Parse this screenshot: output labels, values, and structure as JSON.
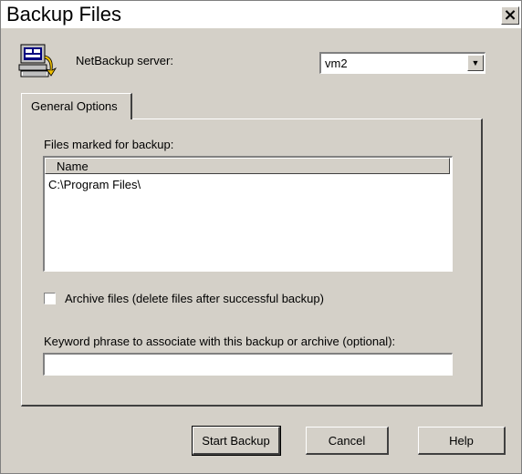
{
  "window": {
    "title": "Backup Files",
    "close_glyph": "×"
  },
  "server": {
    "icon": "computer-server-icon",
    "label": "NetBackup server:",
    "selected": "vm2",
    "arrow_glyph": "▼"
  },
  "tabs": [
    {
      "label": "General Options",
      "active": true
    }
  ],
  "files": {
    "label": "Files marked for backup:",
    "columns": [
      "Name"
    ],
    "rows": [
      "C:\\Program Files\\"
    ]
  },
  "archive": {
    "label": "Archive files (delete files after successful backup)",
    "checked": false
  },
  "keyword": {
    "label": "Keyword phrase to associate with this backup or archive (optional):",
    "value": ""
  },
  "buttons": {
    "start": "Start Backup",
    "cancel": "Cancel",
    "help": "Help"
  },
  "colors": {
    "face": "#d4d0c8",
    "shadow": "#808080",
    "dark_shadow": "#404040"
  }
}
